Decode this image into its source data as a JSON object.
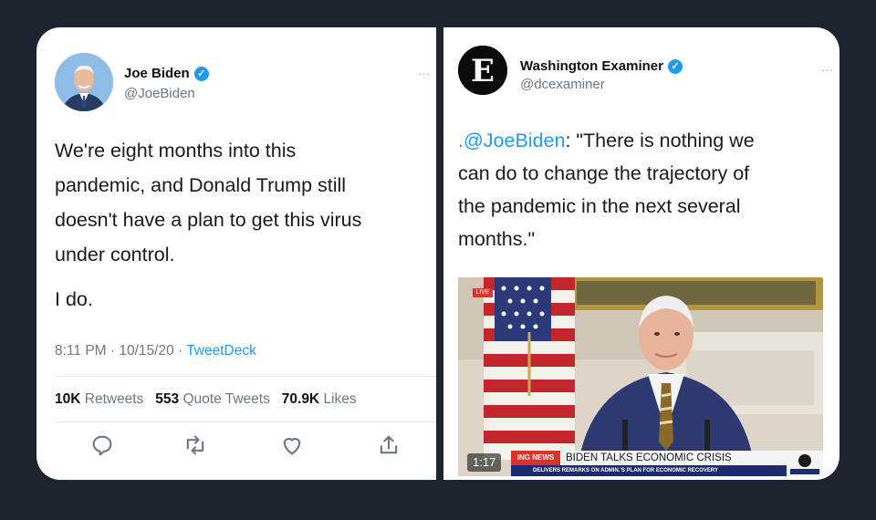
{
  "left_tweet": {
    "author_name": "Joe Biden",
    "handle": "@JoeBiden",
    "more_label": "...",
    "body_lines": [
      "We're eight months into this",
      "pandemic, and Donald Trump still",
      "doesn't have a plan to get this virus",
      "under control."
    ],
    "body_second": "I do.",
    "time": "8:11 PM · 10/15/20 · ",
    "source": "TweetDeck",
    "stats": {
      "retweets_count": "10K",
      "retweets_label": "Retweets",
      "quotes_count": "553",
      "quotes_label": "Quote Tweets",
      "likes_count": "70.9K",
      "likes_label": "Likes"
    }
  },
  "right_tweet": {
    "author_name": "Washington Examiner",
    "handle": "@dcexaminer",
    "more_label": "...",
    "mention": ".@JoeBiden",
    "quote_first": ": \"There is nothing we",
    "quote_lines": [
      "can do to change the trajectory of",
      "the pandemic in the next several",
      "months.\""
    ],
    "video": {
      "time": "1:17",
      "live": "LIVE",
      "network": "ING NEWS",
      "headline": "BIDEN TALKS ECONOMIC CRISIS",
      "subline": "DELIVERS REMARKS ON ADMIN.'S PLAN FOR ECONOMIC RECOVERY"
    }
  },
  "colors": {
    "background": "#1c2430",
    "link": "#1d9bf0",
    "muted": "#6b7782",
    "verified": "#1d9bf0"
  },
  "icons": [
    "reply-icon",
    "retweet-icon",
    "like-icon",
    "share-icon",
    "verified-badge-icon"
  ]
}
